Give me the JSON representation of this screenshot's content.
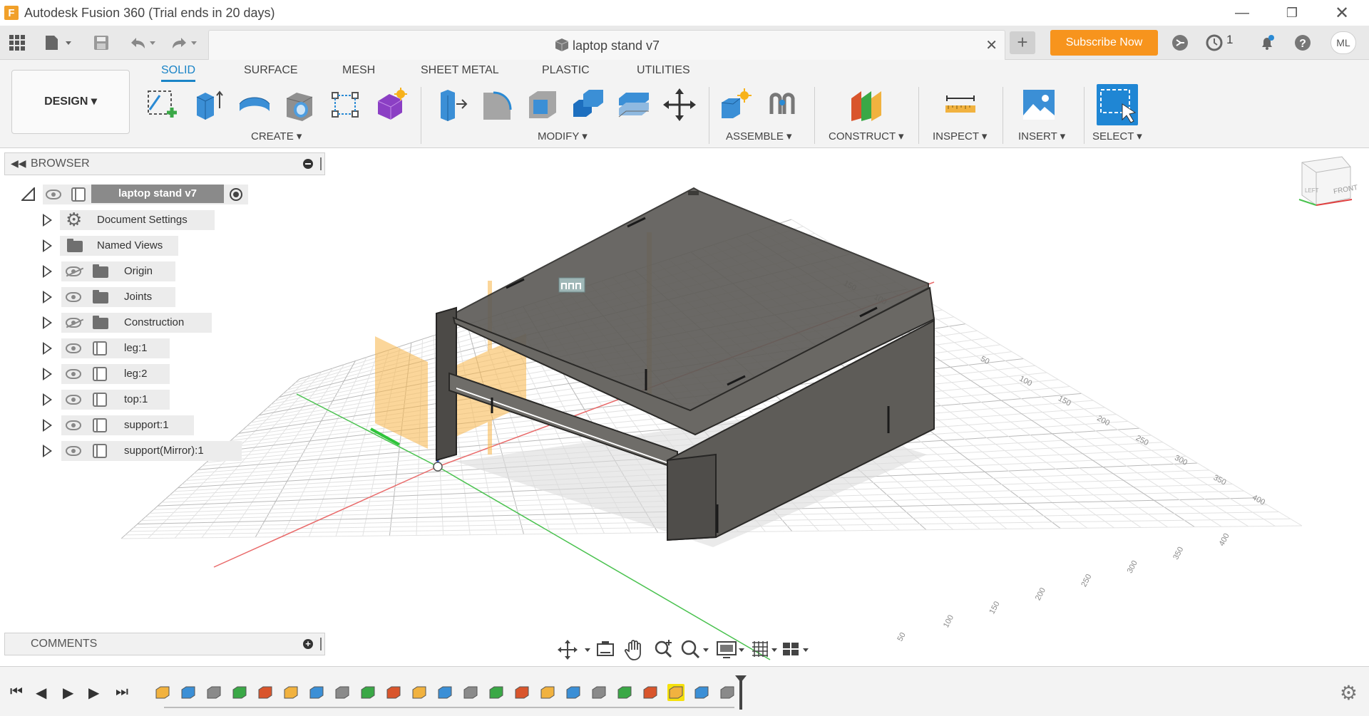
{
  "window": {
    "title": "Autodesk Fusion 360 (Trial ends in 20 days)",
    "logo_letter": "F"
  },
  "tabbar": {
    "document_title": "laptop stand v7",
    "subscribe_label": "Subscribe Now",
    "jobs_count": "1",
    "user_initials": "ML"
  },
  "workspace": {
    "design_label": "DESIGN"
  },
  "toolbar": {
    "tabs": [
      "SOLID",
      "SURFACE",
      "MESH",
      "SHEET METAL",
      "PLASTIC",
      "UTILITIES"
    ],
    "active_tab": "SOLID",
    "groups": {
      "create": "CREATE",
      "modify": "MODIFY",
      "assemble": "ASSEMBLE",
      "construct": "CONSTRUCT",
      "inspect": "INSPECT",
      "insert": "INSERT",
      "select": "SELECT"
    }
  },
  "browser": {
    "title": "BROWSER",
    "root": "laptop stand v7",
    "items": [
      {
        "label": "Document Settings",
        "icon": "gear-icon",
        "visibility": "none"
      },
      {
        "label": "Named Views",
        "icon": "folder-icon",
        "visibility": "none"
      },
      {
        "label": "Origin",
        "icon": "folder-icon",
        "visibility": "hidden"
      },
      {
        "label": "Joints",
        "icon": "folder-icon",
        "visibility": "visible"
      },
      {
        "label": "Construction",
        "icon": "folder-icon",
        "visibility": "hidden"
      },
      {
        "label": "leg:1",
        "icon": "body-icon",
        "visibility": "visible"
      },
      {
        "label": "leg:2",
        "icon": "body-icon",
        "visibility": "visible"
      },
      {
        "label": "top:1",
        "icon": "body-icon",
        "visibility": "visible"
      },
      {
        "label": "support:1",
        "icon": "body-icon",
        "visibility": "visible"
      },
      {
        "label": "support(Mirror):1",
        "icon": "body-icon",
        "visibility": "visible"
      }
    ]
  },
  "comments": {
    "title": "COMMENTS"
  },
  "viewcube": {
    "front_label": "FRONT",
    "left_label": "LEFT"
  },
  "grid_labels": {
    "back_axis": [
      "150",
      "100",
      "50"
    ],
    "right_axis": [
      "50",
      "100",
      "150",
      "200",
      "250",
      "300",
      "350",
      "400"
    ],
    "front_axis": [
      "400",
      "350",
      "300",
      "250",
      "200",
      "150",
      "100",
      "50"
    ]
  },
  "timeline": {
    "item_count": 23,
    "selected_index": 20
  },
  "colors": {
    "accent": "#1a84c7",
    "subscribe": "#f7941d",
    "plane": "#f8b548",
    "body": "#5d5b57",
    "timeline_select": "#f6e10c"
  }
}
